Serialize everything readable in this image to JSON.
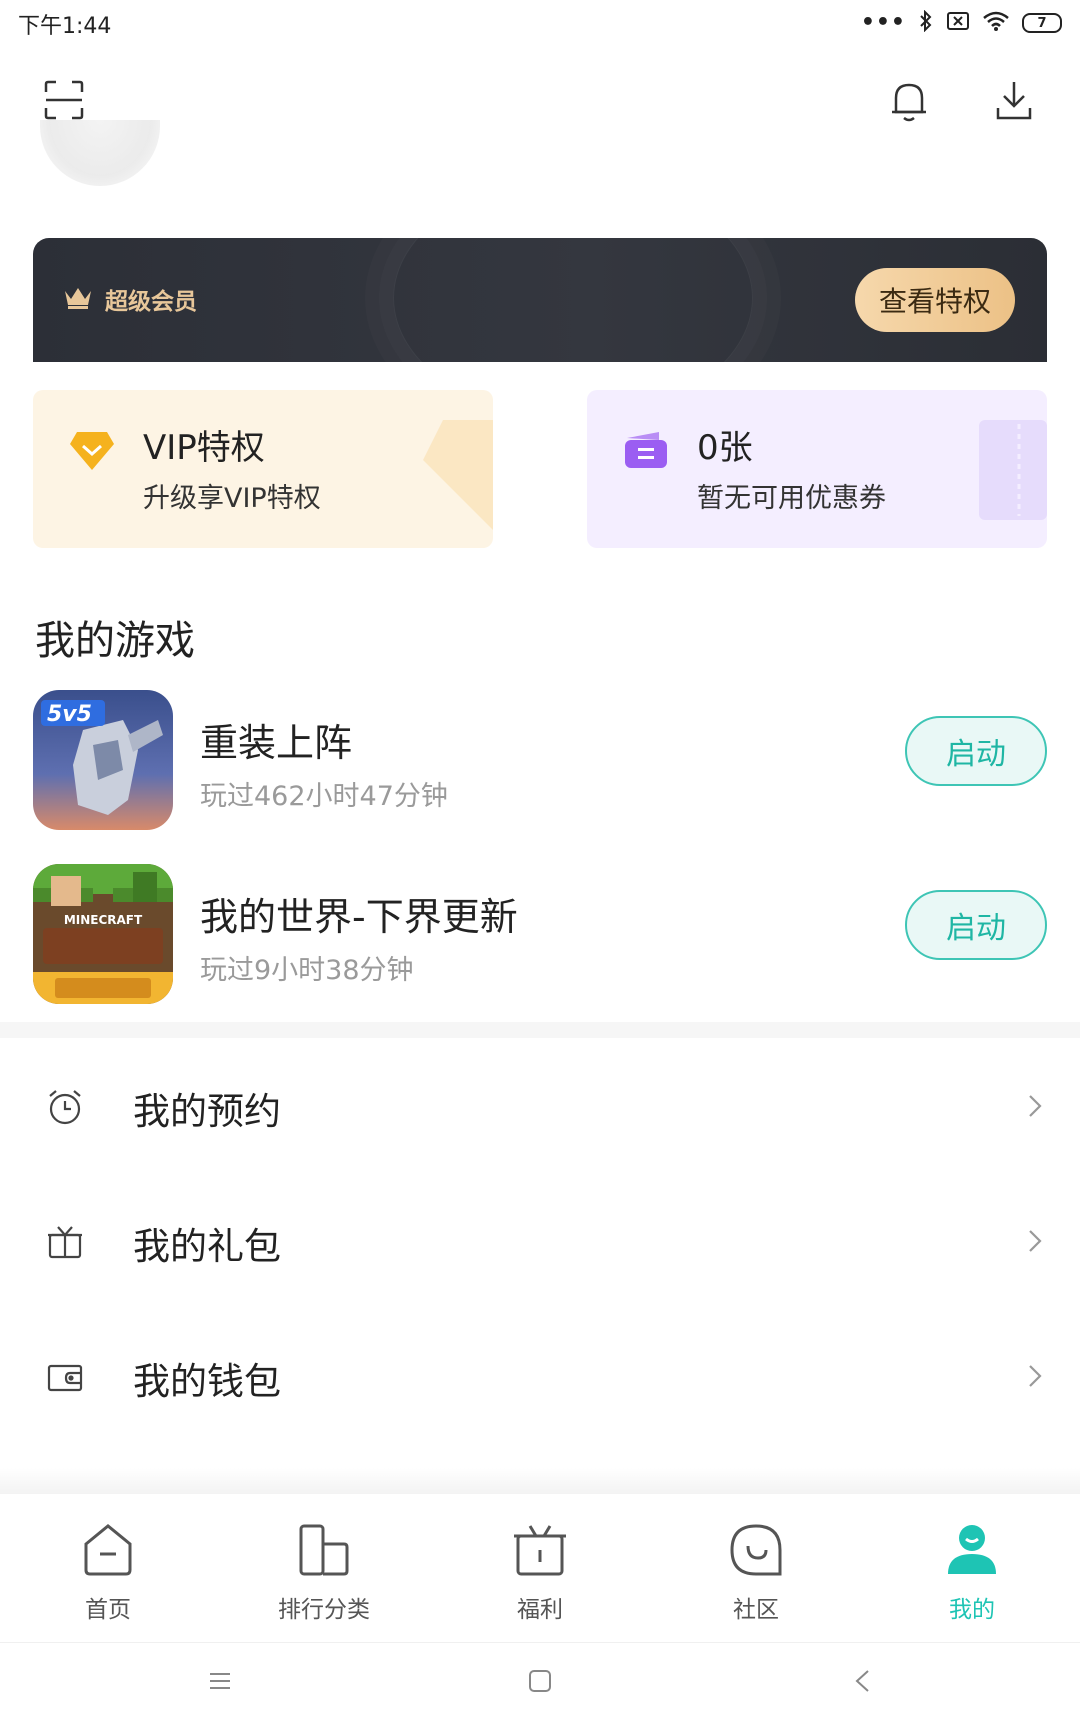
{
  "status_bar": {
    "time": "下午1:44",
    "battery": "7"
  },
  "header": {
    "scan_icon": "scan-icon",
    "bell_icon": "bell-icon",
    "download_icon": "download-icon"
  },
  "vip_banner": {
    "title": "超级会员",
    "cta": "查看特权"
  },
  "cards": {
    "vip": {
      "title": "VIP特权",
      "subtitle": "升级享VIP特权"
    },
    "coupon": {
      "title": "0张",
      "subtitle": "暂无可用优惠券"
    }
  },
  "games": {
    "section_title": "我的游戏",
    "items": [
      {
        "name": "重装上阵",
        "playtime": "玩过462小时47分钟",
        "action": "启动"
      },
      {
        "name": "我的世界-下界更新",
        "playtime": "玩过9小时38分钟",
        "action": "启动"
      }
    ]
  },
  "menu": {
    "items": [
      {
        "label": "我的预约",
        "icon": "alarm-clock-icon"
      },
      {
        "label": "我的礼包",
        "icon": "gift-box-icon"
      },
      {
        "label": "我的钱包",
        "icon": "wallet-icon"
      }
    ]
  },
  "bottom_nav": {
    "items": [
      {
        "label": "首页",
        "icon": "home-icon"
      },
      {
        "label": "排行分类",
        "icon": "ranking-icon"
      },
      {
        "label": "福利",
        "icon": "gift-icon"
      },
      {
        "label": "社区",
        "icon": "community-icon"
      },
      {
        "label": "我的",
        "icon": "profile-icon"
      }
    ],
    "active_index": 4
  },
  "colors": {
    "accent": "#1ec4b4",
    "vip_gold": "#e8c79a",
    "vip_bg": "#2c2f37"
  }
}
